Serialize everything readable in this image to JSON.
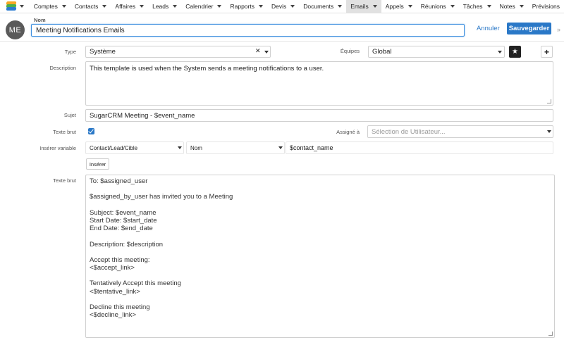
{
  "nav": {
    "items": [
      {
        "label": "Comptes",
        "active": false
      },
      {
        "label": "Contacts",
        "active": false
      },
      {
        "label": "Affaires",
        "active": false
      },
      {
        "label": "Leads",
        "active": false
      },
      {
        "label": "Calendrier",
        "active": false
      },
      {
        "label": "Rapports",
        "active": false
      },
      {
        "label": "Devis",
        "active": false
      },
      {
        "label": "Documents",
        "active": false
      },
      {
        "label": "Emails",
        "active": true
      },
      {
        "label": "Appels",
        "active": false
      },
      {
        "label": "Réunions",
        "active": false
      },
      {
        "label": "Tâches",
        "active": false
      },
      {
        "label": "Notes",
        "active": false
      },
      {
        "label": "Prévisions",
        "active": false
      }
    ]
  },
  "header": {
    "avatar_initials": "ME",
    "name_label": "Nom",
    "name_value": "Meeting Notifications Emails",
    "cancel_label": "Annuler",
    "save_label": "Sauvegarder"
  },
  "form": {
    "type_label": "Type",
    "type_value": "Système",
    "teams_label": "Équipes",
    "teams_value": "Global",
    "description_label": "Description",
    "description_value": "This template is used when the System sends a meeting notifications to a user.",
    "subject_label": "Sujet",
    "subject_value": "SugarCRM Meeting - $event_name",
    "plain_text_label": "Texte brut",
    "plain_text_checked": true,
    "assigned_label": "Assigné à",
    "assigned_placeholder": "Sélection de Utilisateur...",
    "insert_var_label": "Insérer variable",
    "var_module": "Contact/Lead/Cible",
    "var_field": "Nom",
    "var_value": "$contact_name",
    "insert_button": "Insérer",
    "body_label": "Texte brut",
    "body_lines": [
      "To: $assigned_user",
      "",
      "$assigned_by_user has invited you to a Meeting",
      "",
      "Subject: $event_name",
      "Start Date: $start_date",
      "End Date: $end_date",
      "",
      "Description: $description",
      "",
      "Accept this meeting:",
      "<$accept_link>",
      "",
      "Tentatively Accept this meeting",
      "<$tentative_link>",
      "",
      "Decline this meeting",
      "<$decline_link>"
    ]
  },
  "colors": {
    "accent": "#2a78c7",
    "avatar": "#5a5a5a",
    "active_nav": "#e1e1e1"
  },
  "icons": {
    "logo": "sugarcrm-logo-icon",
    "star": "star-icon",
    "plus": "plus-icon",
    "clear": "close-icon",
    "dropdown": "chevron-down-icon"
  }
}
